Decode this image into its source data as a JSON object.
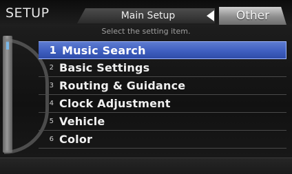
{
  "header": {
    "title": "SETUP",
    "main_tab": "Main Setup",
    "other_tab": "Other",
    "instruction": "Select the setting item."
  },
  "menu": {
    "items": [
      {
        "num": "1",
        "label": "Music Search",
        "selected": true
      },
      {
        "num": "2",
        "label": "Basic Settings",
        "selected": false
      },
      {
        "num": "3",
        "label": "Routing & Guidance",
        "selected": false
      },
      {
        "num": "4",
        "label": "Clock Adjustment",
        "selected": false
      },
      {
        "num": "5",
        "label": "Vehicle",
        "selected": false
      },
      {
        "num": "6",
        "label": "Color",
        "selected": false
      }
    ]
  },
  "colors": {
    "selected_bg": "#3f5fc0",
    "scroll_accent": "#7ab8e8"
  }
}
